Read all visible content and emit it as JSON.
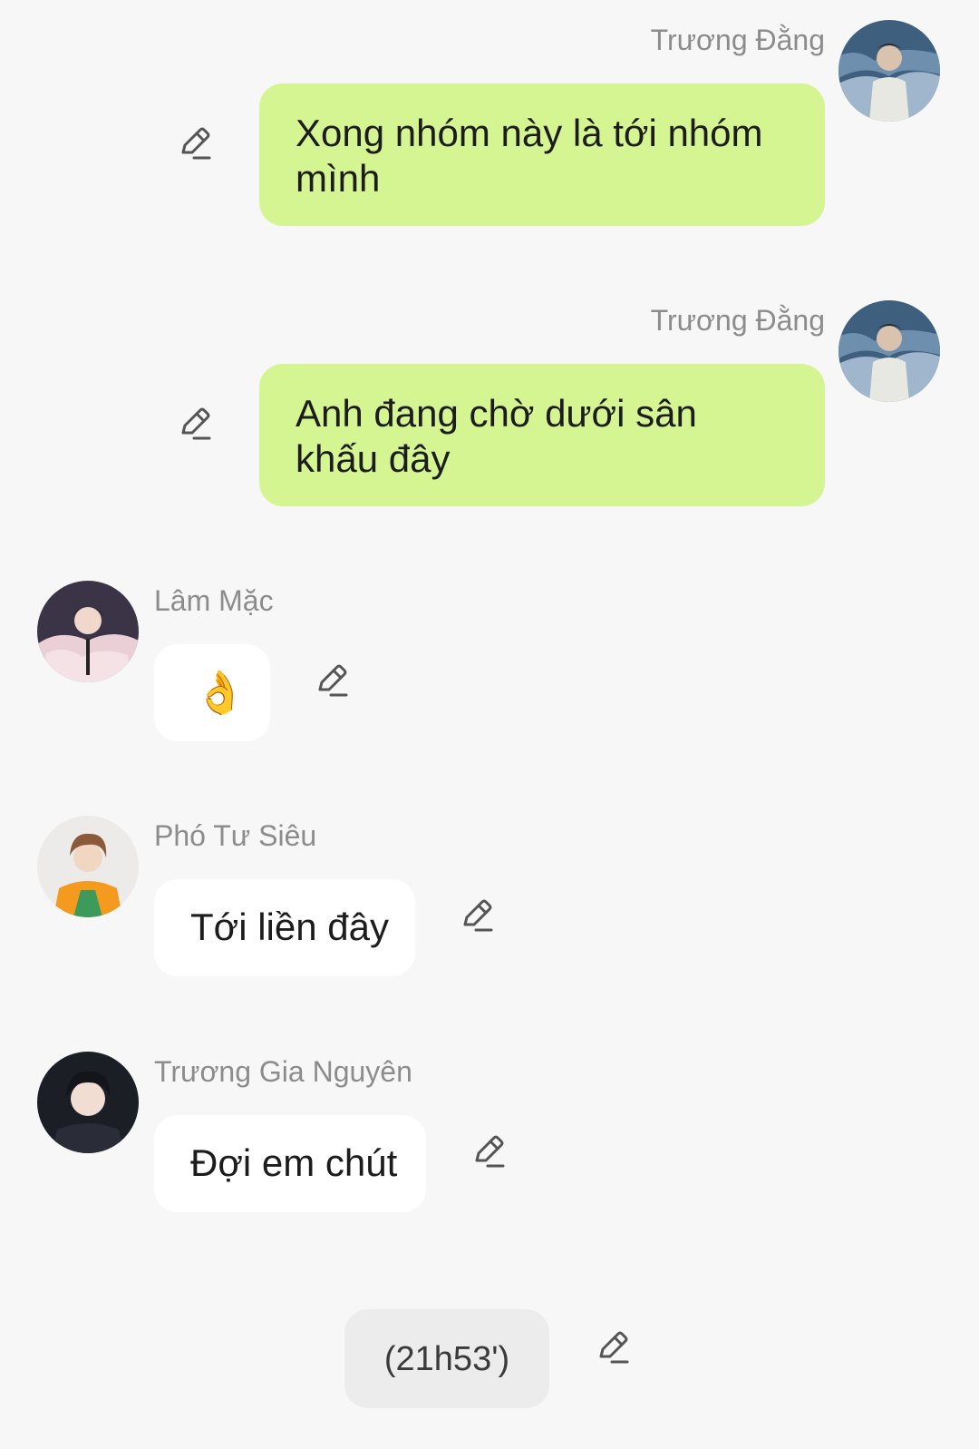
{
  "messages": [
    {
      "sender": "Trương Đằng",
      "text": "Xong nhóm này là tới nhóm mình",
      "avatar_icon": "user-avatar-icon"
    },
    {
      "sender": "Trương Đằng",
      "text": "Anh đang chờ dưới sân khấu đây",
      "avatar_icon": "user-avatar-icon"
    },
    {
      "sender": "Lâm Mặc",
      "text": "👌",
      "avatar_icon": "user-avatar-icon"
    },
    {
      "sender": "Phó Tư Siêu",
      "text": "Tới liền đây",
      "avatar_icon": "user-avatar-icon"
    },
    {
      "sender": "Trương Gia Nguyên",
      "text": "Đợi em chút",
      "avatar_icon": "user-avatar-icon"
    }
  ],
  "time_marker": {
    "text": "(21h53')"
  },
  "icons": {
    "edit": "pencil-edit-icon"
  },
  "colors": {
    "background": "#f7f7f7",
    "outgoing_bubble": "#d5f593",
    "incoming_bubble": "#ffffff",
    "time_bubble": "#ececec",
    "sender_name": "#8c8c8c"
  }
}
